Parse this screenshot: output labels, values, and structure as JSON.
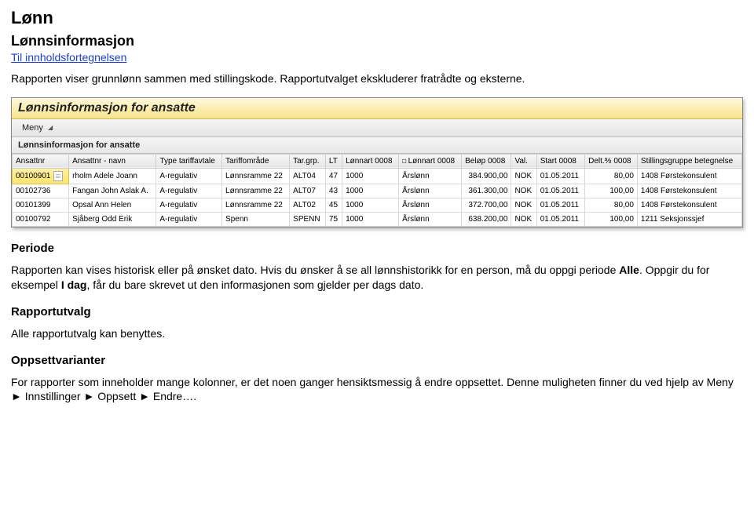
{
  "page": {
    "h1": "Lønn",
    "h2": "Lønnsinformasjon",
    "toc_link": "Til innholdsfortegnelsen",
    "intro": "Rapporten viser grunnlønn sammen med stillingskode. Rapportutvalget ekskluderer fratrådte og eksterne."
  },
  "report": {
    "title": "Lønnsinformasjon for ansatte",
    "menu_label": "Meny",
    "subtitle": "Lønnsinformasjon for ansatte",
    "columns": [
      "Ansattnr",
      "Ansattnr - navn",
      "Type tariffavtale",
      "Tariffområde",
      "Tar.grp.",
      "LT",
      "Lønnart 0008",
      "Lønnart 0008",
      "Beløp 0008",
      "Val.",
      "Start 0008",
      "Delt.% 0008",
      "Stillingsgruppe betegnelse"
    ],
    "pin_col_index": 7,
    "rows": [
      {
        "id": "00100901",
        "selected": true,
        "name": "rholm Adele Joann",
        "type": "A-regulativ",
        "omrade": "Lønnsramme 22",
        "grp": "ALT04",
        "lt": "47",
        "art1": "1000",
        "art2": "Årslønn",
        "belop": "384.900,00",
        "val": "NOK",
        "start": "01.05.2011",
        "delt": "80,00",
        "stilling": "1408 Førstekonsulent"
      },
      {
        "id": "00102736",
        "selected": false,
        "name": "Fangan John Aslak A.",
        "type": "A-regulativ",
        "omrade": "Lønnsramme 22",
        "grp": "ALT07",
        "lt": "43",
        "art1": "1000",
        "art2": "Årslønn",
        "belop": "361.300,00",
        "val": "NOK",
        "start": "01.05.2011",
        "delt": "100,00",
        "stilling": "1408 Førstekonsulent"
      },
      {
        "id": "00101399",
        "selected": false,
        "name": "Opsal Ann Helen",
        "type": "A-regulativ",
        "omrade": "Lønnsramme 22",
        "grp": "ALT02",
        "lt": "45",
        "art1": "1000",
        "art2": "Årslønn",
        "belop": "372.700,00",
        "val": "NOK",
        "start": "01.05.2011",
        "delt": "80,00",
        "stilling": "1408 Førstekonsulent"
      },
      {
        "id": "00100792",
        "selected": false,
        "name": "Sjåberg Odd Erik",
        "type": "A-regulativ",
        "omrade": "Spenn",
        "grp": "SPENN",
        "lt": "75",
        "art1": "1000",
        "art2": "Årslønn",
        "belop": "638.200,00",
        "val": "NOK",
        "start": "01.05.2011",
        "delt": "100,00",
        "stilling": "1211 Seksjonssjef"
      }
    ]
  },
  "sections": {
    "periode_h": "Periode",
    "periode_t1": "Rapporten kan vises historisk eller på ønsket dato. Hvis du ønsker å se all lønnshistorikk for en person, må du oppgi periode ",
    "periode_b1": "Alle",
    "periode_t2": ". Oppgir du for eksempel ",
    "periode_b2": "I dag",
    "periode_t3": ", får du bare skrevet ut den informasjonen som gjelder per dags dato.",
    "rapportutvalg_h": "Rapportutvalg",
    "rapportutvalg_t": "Alle rapportutvalg kan benyttes.",
    "oppsett_h": "Oppsettvarianter",
    "oppsett_t": "For rapporter som inneholder mange kolonner, er det noen ganger hensiktsmessig å endre oppsettet. Denne muligheten finner du ved hjelp av Meny ► Innstillinger ► Oppsett ► Endre…."
  }
}
